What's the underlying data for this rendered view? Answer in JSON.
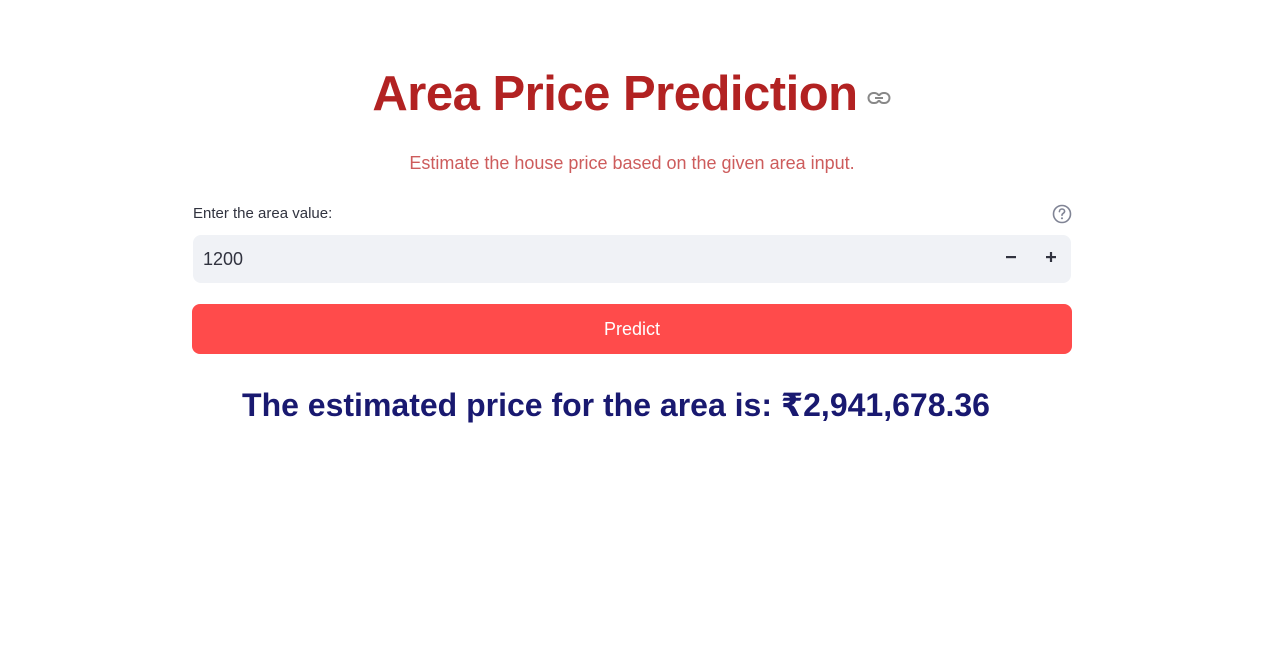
{
  "header": {
    "title": "Area Price Prediction",
    "subtitle": "Estimate the house price based on the given area input."
  },
  "area_input": {
    "label": "Enter the area value:",
    "value": "1200",
    "decrement_label": "−",
    "increment_label": "+"
  },
  "predict_button": {
    "label": "Predict"
  },
  "result": {
    "text": "The estimated price for the area is: ₹2,941,678.36"
  },
  "colors": {
    "title": "#b22222",
    "subtitle": "#cd5c5c",
    "button": "#ff4b4b",
    "result": "#191970",
    "input_bg": "#f0f2f6"
  },
  "icons": {
    "anchor": "link-icon",
    "help": "help-circle-icon",
    "decrement": "minus-icon",
    "increment": "plus-icon"
  }
}
